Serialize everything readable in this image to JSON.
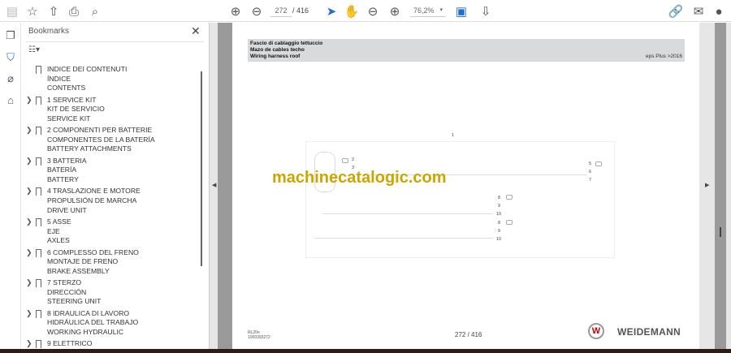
{
  "toolbar": {
    "page_current": "272",
    "page_total": "/ 416",
    "zoom": "76,2%"
  },
  "icons": {
    "save": "save-icon",
    "bookmark": "star-icon",
    "upload": "cloud-upload-icon",
    "print": "print-icon",
    "find": "search-icon",
    "prev": "arrow-up-circle-icon",
    "next": "arrow-down-circle-icon",
    "select": "pointer-icon",
    "hand": "hand-icon",
    "zoom_out": "minus-circle-icon",
    "zoom_in": "plus-circle-icon",
    "fit": "page-fit-icon",
    "scroll": "scroll-mode-icon",
    "share": "share-link-icon",
    "mail": "mail-icon",
    "account": "account-icon"
  },
  "accent": "#1f6fd1",
  "bookmarks": {
    "title": "Bookmarks",
    "items": [
      {
        "lines": [
          "INDICE DEI CONTENUTI",
          "ÍNDICE",
          "CONTENTS"
        ],
        "expandable": false
      },
      {
        "lines": [
          "1 SERVICE KIT",
          "KIT DE SERVICIO",
          "SERVICE KIT"
        ],
        "expandable": true
      },
      {
        "lines": [
          "2 COMPONENTI PER BATTERIE",
          "COMPONENTES DE LA BATERÍA",
          "BATTERY ATTACHMENTS"
        ],
        "expandable": true
      },
      {
        "lines": [
          "3 BATTERIA",
          "BATERÍA",
          "BATTERY"
        ],
        "expandable": true
      },
      {
        "lines": [
          "4 TRASLAZIONE E MOTORE",
          "PROPULSIÓN DE MARCHA",
          "DRIVE UNIT"
        ],
        "expandable": true
      },
      {
        "lines": [
          "5 ASSE",
          "EJE",
          "AXLES"
        ],
        "expandable": true
      },
      {
        "lines": [
          "6 COMPLESSO DEL FRENO",
          "MONTAJE DE FRENO",
          "BRAKE ASSEMBLY"
        ],
        "expandable": true
      },
      {
        "lines": [
          "7 STERZO",
          "DIRECCIÓN",
          "STEERING UNIT"
        ],
        "expandable": true
      },
      {
        "lines": [
          "8 IDRAULICA DI LAVORO",
          "HIDRÁULICA DEL TRABAJO",
          "WORKING HYDRAULIC"
        ],
        "expandable": true
      },
      {
        "lines": [
          "9 ELETTRICO",
          "",
          ""
        ],
        "expandable": true
      }
    ]
  },
  "document": {
    "header_lines": [
      "Fascio di cablaggio tettuccio",
      "Mazo de cables techo",
      "Wiring harness roof"
    ],
    "header_right": "eps Plus >2016",
    "diagram_title": "1",
    "diagram_labels": [
      "2",
      "3",
      "5",
      "6",
      "7",
      "8",
      "9",
      "10",
      "8",
      "9",
      "10"
    ],
    "watermark": "machinecatalogic.com",
    "footer_model": "RL20e",
    "footer_code": "1000393272",
    "footer_page": "272 / 416",
    "brand": "WEIDEMANN",
    "logo_letter": "W"
  }
}
